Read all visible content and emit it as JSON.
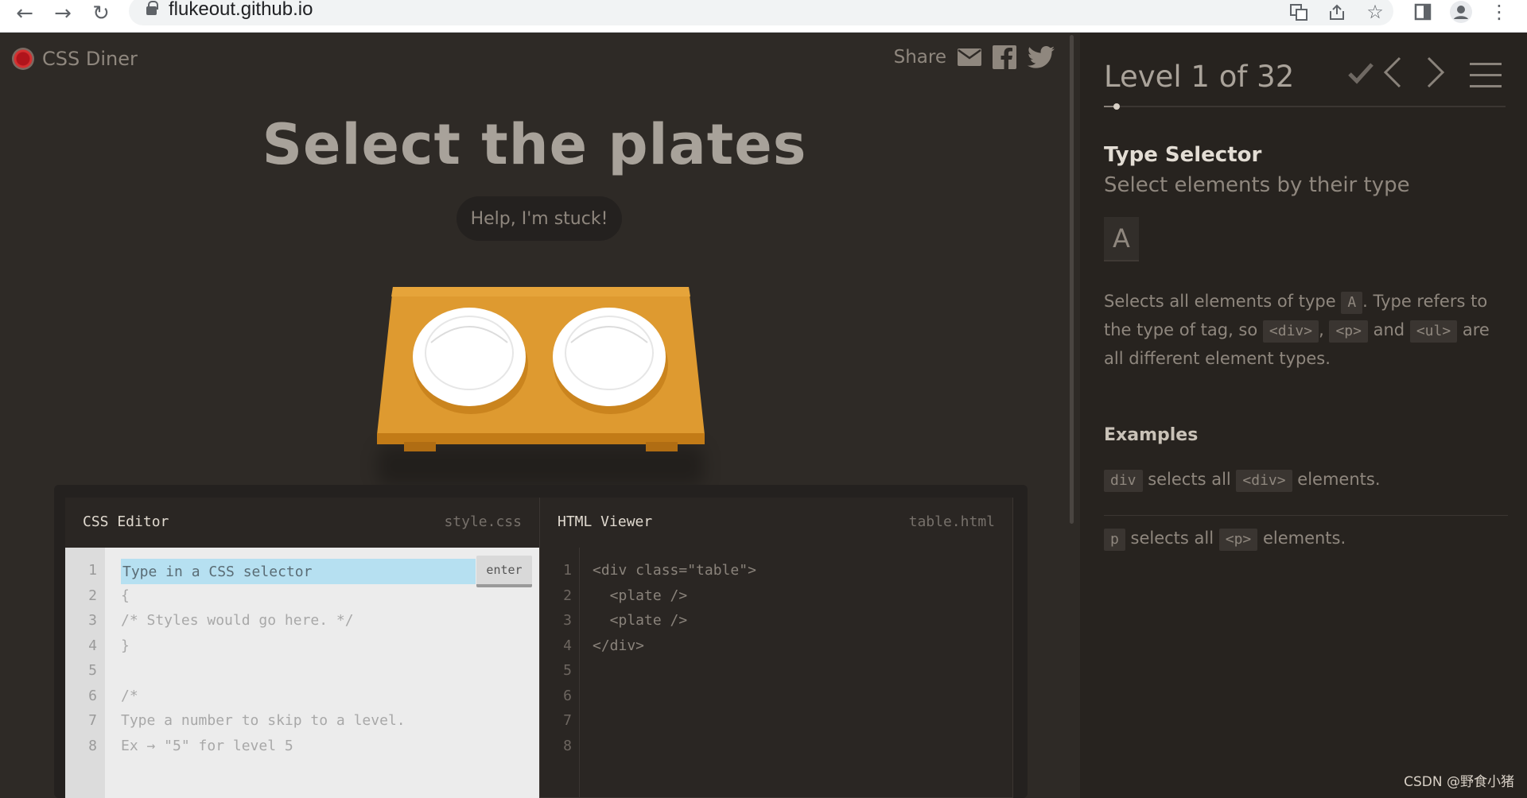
{
  "browser": {
    "url": "flukeout.github.io"
  },
  "header": {
    "brand": "CSS Diner",
    "share_label": "Share"
  },
  "game": {
    "order": "Select the plates",
    "help_button": "Help, I'm stuck!"
  },
  "css_editor": {
    "title": "CSS Editor",
    "filename": "style.css",
    "input_placeholder": "Type in a CSS selector",
    "enter_label": "enter",
    "line_numbers": [
      "1",
      "2",
      "3",
      "4",
      "5",
      "6",
      "7",
      "8"
    ],
    "lines": {
      "l2": "{",
      "l3": "/* Styles would go here. */",
      "l4": "}",
      "l6": "/*",
      "l7": "Type a number to skip to a level.",
      "l8": "Ex → \"5\" for level 5"
    }
  },
  "html_viewer": {
    "title": "HTML Viewer",
    "filename": "table.html",
    "line_numbers": [
      "1",
      "2",
      "3",
      "4",
      "5",
      "6",
      "7",
      "8"
    ],
    "lines": [
      "<div class=\"table\">",
      "  <plate />",
      "  <plate />",
      "</div>"
    ]
  },
  "sidebar": {
    "level_title": "Level 1 of 32",
    "progress_fraction": 0.03125,
    "selector_name": "Type Selector",
    "selector_title": "Select elements by their type",
    "syntax": "A",
    "hint": {
      "t1": "Selects all elements of type ",
      "tag_a": "A",
      "t2": ". Type refers to the type of tag, so ",
      "tag_div": "<div>",
      "t3": ", ",
      "tag_p": "<p>",
      "t4": " and ",
      "tag_ul": "<ul>",
      "t5": " are all different element types."
    },
    "examples_title": "Examples",
    "examples": [
      {
        "code": "div",
        "t1": " selects all ",
        "tag": "<div>",
        "t2": " elements."
      },
      {
        "code": "p",
        "t1": " selects all ",
        "tag": "<p>",
        "t2": " elements."
      }
    ]
  },
  "watermark": "CSDN @野食小猪",
  "colors": {
    "background": "#2e2a26",
    "sidebar": "#27231f",
    "table": "#de9a30",
    "plate": "#ffffff",
    "input_highlight": "#b6e0f1"
  }
}
